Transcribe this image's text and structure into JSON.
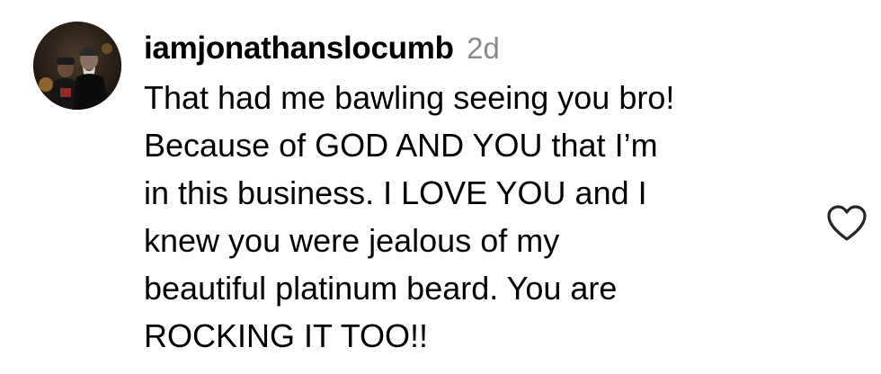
{
  "comment": {
    "username": "iamjonathanslocumb",
    "timestamp": "2d",
    "lines": [
      "That had me bawling seeing you bro!",
      "Because of GOD AND YOU that I’m",
      "in this business. I LOVE YOU and I",
      "knew you were jealous of my",
      "beautiful platinum beard. You are",
      "ROCKING IT TOO!!"
    ],
    "avatar_icon": "user-avatar-photo",
    "like_icon": "heart-outline-icon"
  },
  "colors": {
    "text": "#000000",
    "timestamp": "#8a8a8a",
    "icon_stroke": "#262626",
    "background": "#ffffff"
  }
}
